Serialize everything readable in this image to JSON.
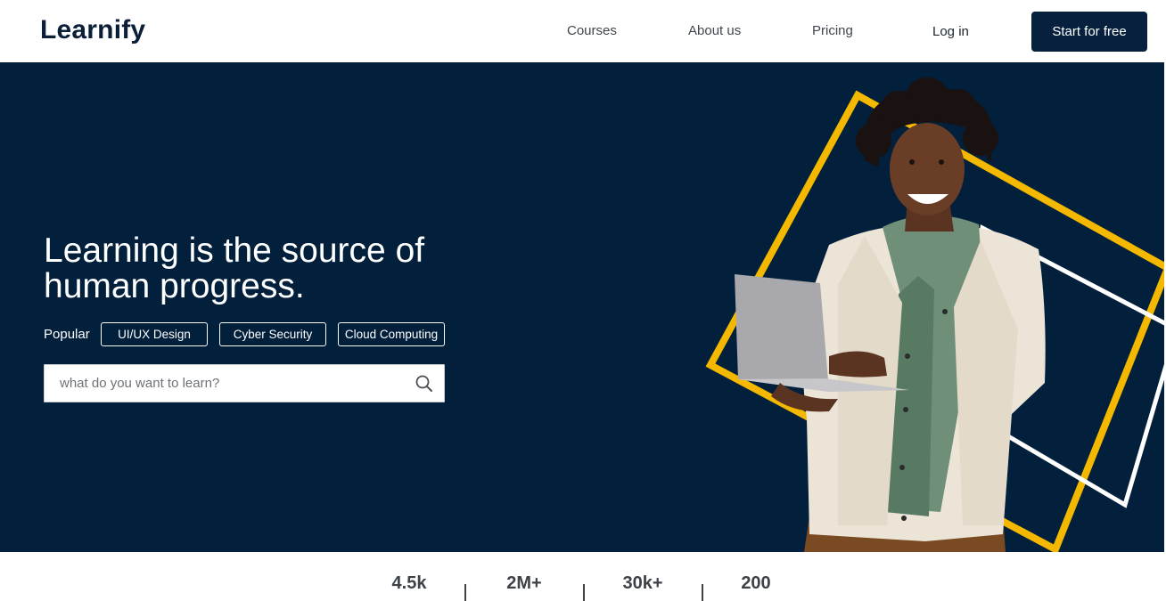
{
  "brand": {
    "name": "Learnify"
  },
  "nav": {
    "items": [
      {
        "label": "Courses"
      },
      {
        "label": "About us"
      },
      {
        "label": "Pricing"
      }
    ],
    "login_label": "Log in",
    "cta_label": "Start for free"
  },
  "hero": {
    "title": "Learning is the source of human progress.",
    "popular_label": "Popular",
    "chips": [
      {
        "label": "UI/UX Design"
      },
      {
        "label": "Cyber Security"
      },
      {
        "label": "Cloud Computing"
      }
    ],
    "search": {
      "placeholder": "what do you want to learn?",
      "value": ""
    }
  },
  "stats": [
    {
      "value": "4.5k",
      "label": ""
    },
    {
      "value": "2M+",
      "label": ""
    },
    {
      "value": "30k+",
      "label": ""
    },
    {
      "value": "200",
      "label": ""
    }
  ],
  "colors": {
    "navy": "#02203c",
    "cta": "#06203d",
    "accent_yellow": "#f5b800",
    "white": "#ffffff"
  }
}
